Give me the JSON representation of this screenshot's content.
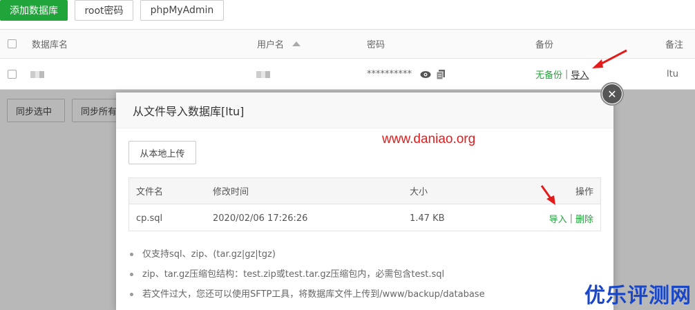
{
  "toolbar": {
    "add_db": "添加数据库",
    "root_pwd": "root密码",
    "phpmyadmin": "phpMyAdmin"
  },
  "db_table": {
    "headers": {
      "name": "数据库名",
      "user": "用户名",
      "password": "密码",
      "backup": "备份",
      "note": "备注"
    },
    "row": {
      "password_mask": "**********",
      "backup_status": "无备份",
      "separator": "|",
      "import_link": "导入",
      "note": "ltu"
    }
  },
  "bottom_buttons": {
    "sync_selected": "同步选中",
    "sync_all": "同步所有"
  },
  "modal": {
    "title": "从文件导入数据库[ltu]",
    "upload_btn": "从本地上传",
    "headers": {
      "filename": "文件名",
      "mtime": "修改时间",
      "size": "大小",
      "actions": "操作"
    },
    "file": {
      "name": "cp.sql",
      "mtime": "2020/02/06 17:26:26",
      "size": "1.47 KB",
      "import": "导入",
      "sep": "|",
      "delete": "删除"
    },
    "notes": [
      "仅支持sql、zip、(tar.gz|gz|tgz)",
      "zip、tar.gz压缩包结构：test.zip或test.tar.gz压缩包内，必需包含test.sql",
      "若文件过大，您还可以使用SFTP工具，将数据库文件上传到/www/backup/database"
    ]
  },
  "watermark": {
    "url": "www.daniao.org",
    "brand": "优乐评测网"
  },
  "colors": {
    "accent_green": "#20a53a",
    "annotation_red": "#e31b1b",
    "brand_blue": "#1a47c8"
  }
}
